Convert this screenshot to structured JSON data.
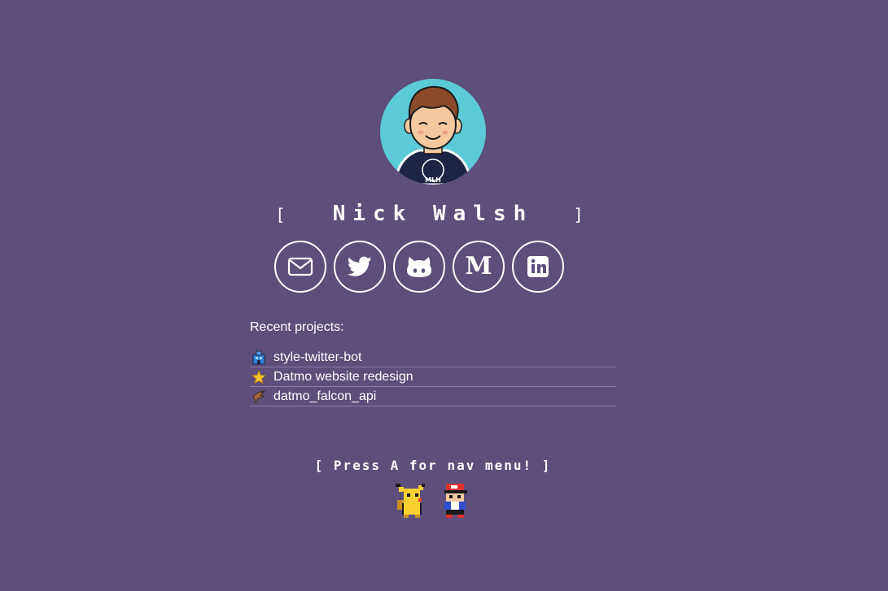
{
  "profile": {
    "name": "Nick Walsh",
    "bracket_open": "[",
    "bracket_close": "]",
    "avatar_shirt_text": "MLH"
  },
  "socials": [
    {
      "label": "Email",
      "icon": "mail-icon"
    },
    {
      "label": "Twitter",
      "icon": "twitter-icon"
    },
    {
      "label": "GitHub",
      "icon": "github-icon"
    },
    {
      "label": "Medium",
      "icon": "medium-icon",
      "glyph": "M"
    },
    {
      "label": "LinkedIn",
      "icon": "linkedin-icon"
    }
  ],
  "recent": {
    "heading": "Recent projects:",
    "projects": [
      {
        "name": "style-twitter-bot",
        "icon": "blue-building-icon"
      },
      {
        "name": "Datmo website redesign",
        "icon": "star-icon"
      },
      {
        "name": "datmo_falcon_api",
        "icon": "falcon-icon"
      }
    ]
  },
  "nav_prompt": "[ Press A for nav menu! ]",
  "colors": {
    "background": "#5d4e7b",
    "avatar_bg": "#5ccad7",
    "divider": "#8a7ba8",
    "text": "#ffffff"
  }
}
